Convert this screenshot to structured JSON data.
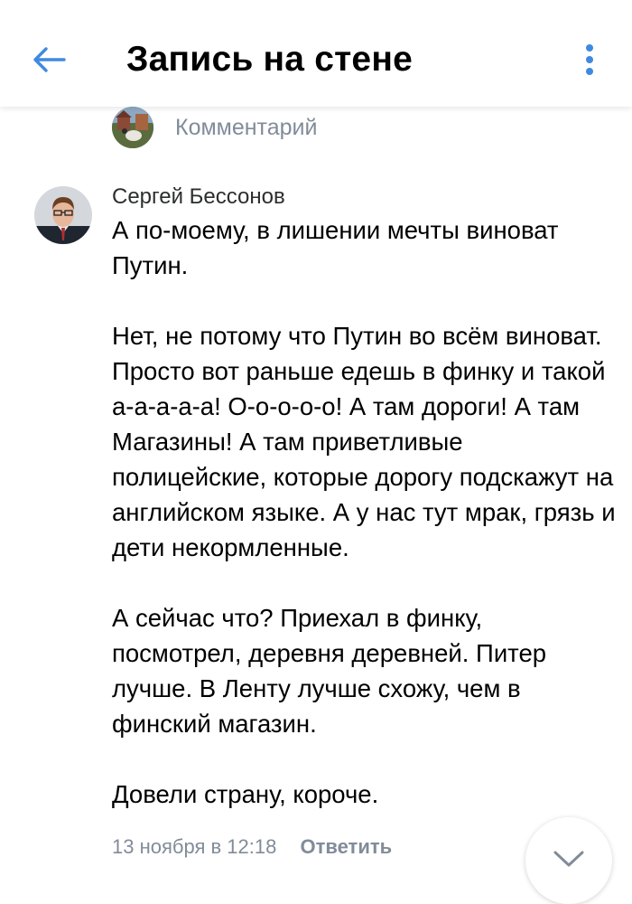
{
  "header": {
    "title": "Запись на стене",
    "back_icon": "arrow-left-icon",
    "menu_icon": "more-vertical-icon",
    "accent_color": "#3f8ae0"
  },
  "reference": {
    "label": "Комментарий",
    "avatar_icon": "avatar-image"
  },
  "comment": {
    "author": "Сергей Бессонов",
    "paragraphs": [
      "А по-моему, в лишении мечты виноват Путин.",
      "Нет, не потому что Путин во всём виноват. Просто вот раньше едешь в финку и такой а-а-а-а-а! О-о-о-о-о! А там дороги! А там Магазины! А там приветливые полицейские, которые дорогу подскажут на английском языке. А у нас тут мрак, грязь и дети некормленные.",
      "А сейчас что? Приехал в финку, посмотрел, деревня деревней. Питер лучше. В Ленту лучше схожу, чем в финский магазин.",
      "Довели страну, короче."
    ],
    "date": "13 ноября в 12:18",
    "reply_label": "Ответить"
  },
  "scroll_button": {
    "icon": "chevron-down-icon"
  }
}
